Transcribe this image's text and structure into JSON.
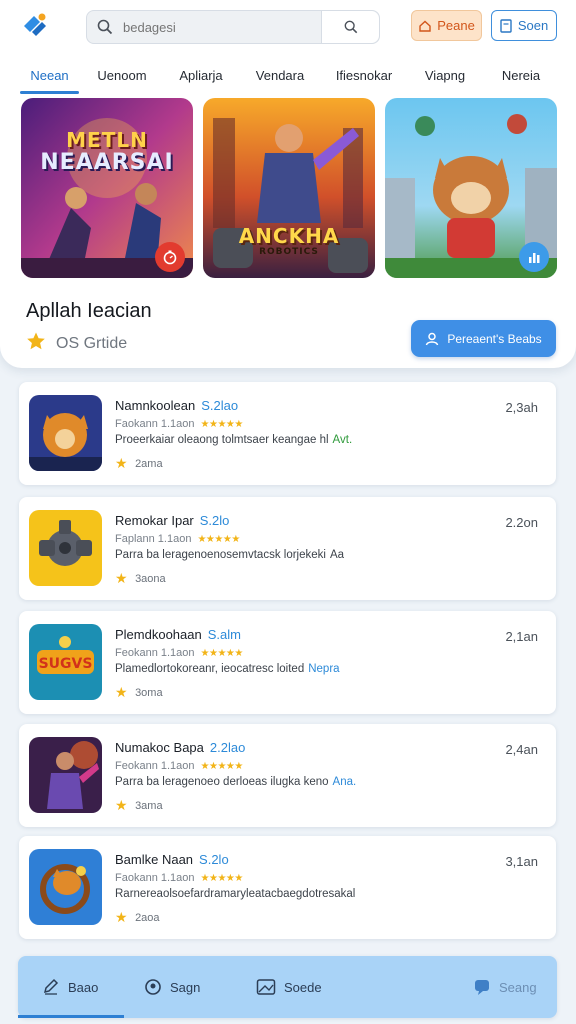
{
  "header": {
    "search_placeholder": "bedagesi",
    "orange_button_label": "Peane",
    "blue_button_label": "Soen"
  },
  "tabs": [
    {
      "label": "Neean",
      "active": true
    },
    {
      "label": "Uenoom",
      "active": false
    },
    {
      "label": "Apliarja",
      "active": false
    },
    {
      "label": "Vendara",
      "active": false
    },
    {
      "label": "Ifiesnokar",
      "active": false
    },
    {
      "label": "Viapng",
      "active": false
    },
    {
      "label": "Nereia",
      "active": false
    }
  ],
  "banners": [
    {
      "title_line1": "METLN",
      "title_line2": "NEAARSAI",
      "badge_icon": "timer-icon",
      "badge_color": "#e23b2f"
    },
    {
      "title_line1": "ANCKHA",
      "title_line2": "ROBOTICS",
      "badge_icon": "none"
    },
    {
      "title_line1": "",
      "title_line2": "",
      "badge_icon": "chart-icon",
      "badge_color": "#3d9be9"
    }
  ],
  "featured": {
    "title": "Apllah Ieacian",
    "subtitle": "OS Grtide",
    "button_label": "Pereaent's Beabs"
  },
  "apps": [
    {
      "name": "Namnkoolean",
      "version": "S.2lao",
      "publisher": "Faokann 1.1aon",
      "description": "Proeerkaiar oleaong tolmtsaer keangae hl",
      "tag": "Avt.",
      "tag_color": "#2f9a3b",
      "rating": "2ama",
      "size": "2,3ah"
    },
    {
      "name": "Remokar Ipar",
      "version": "S.2lo",
      "publisher": "Faplann 1.1aon",
      "description": "Parra ba leragenoenosemvtacsk lorjekeki",
      "tag": "Aa",
      "tag_color": "#3d434b",
      "rating": "3aona",
      "size": "2.2on"
    },
    {
      "name": "Plemdkoohaan",
      "version": "S.alm",
      "publisher": "Feokann 1.1aon",
      "description": "Plamedlortokoreanr, ieocatresc loited",
      "tag": "Nepra",
      "tag_color": "#2d8ad8",
      "rating": "3oma",
      "size": "2,1an"
    },
    {
      "name": "Numakoc Bapa",
      "version": "2.2lao",
      "publisher": "Feokann 1.1aon",
      "description": "Parra ba leragenoeo derloeas ilugka keno",
      "tag": "Ana.",
      "tag_color": "#2d8ad8",
      "rating": "3ama",
      "size": "2,4an"
    },
    {
      "name": "Bamlke Naan",
      "version": "S.2lo",
      "publisher": "Faokann 1.1aon",
      "description": "Rarnereaolsoefardramaryleatacbaegdotresakal",
      "tag": "",
      "tag_color": "#3d434b",
      "rating": "2aoa",
      "size": "3,1an"
    }
  ],
  "bottom_nav": [
    {
      "label": "Baao",
      "icon": "edit-icon",
      "active": true
    },
    {
      "label": "Sagn",
      "icon": "circle-user-icon",
      "active": false
    },
    {
      "label": "Soede",
      "icon": "image-icon",
      "active": false
    },
    {
      "label": "Seang",
      "icon": "chat-icon",
      "active": false
    }
  ],
  "colors": {
    "accent": "#2d7fd3",
    "star": "#f2b418",
    "orange_button_bg": "#fde3c9",
    "bottom_nav_bg": "#a9d3f7"
  }
}
